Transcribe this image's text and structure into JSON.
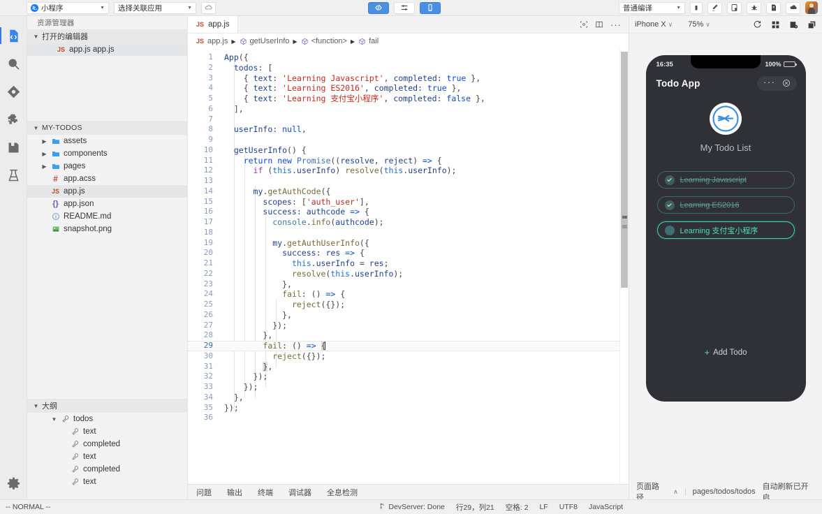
{
  "toolbar": {
    "app_select": {
      "label": "小程序",
      "icon": "alipay-logo-icon",
      "caret": "▼"
    },
    "project_select": {
      "label": "选择关联应用",
      "caret": "▼"
    },
    "cloud_button": "cloud-icon",
    "code_toggle": "code-brackets-icon",
    "settings_toggle": "sliders-icon",
    "device_toggle": "mobile-icon",
    "compile_select": {
      "label": "普通编译",
      "caret": "▼"
    },
    "stop_button": "stop-square-icon",
    "actions": [
      "clean-icon",
      "preview-qr-icon",
      "debug-bug-icon",
      "doc-icon",
      "upload-cloud-icon"
    ],
    "avatar": "user-avatar"
  },
  "activity_bar": {
    "items": [
      {
        "name": "explorer",
        "icon": "code-file-icon",
        "active": true
      },
      {
        "name": "search",
        "icon": "search-icon",
        "active": false
      },
      {
        "name": "source-control",
        "icon": "git-branch-icon",
        "active": false
      },
      {
        "name": "extensions",
        "icon": "puzzle-piece-icon",
        "active": false
      },
      {
        "name": "save-all",
        "icon": "floppy-disk-icon",
        "active": false
      },
      {
        "name": "test",
        "icon": "flask-icon",
        "active": false
      }
    ],
    "bottom": {
      "name": "settings",
      "icon": "gear-icon"
    }
  },
  "sidebar": {
    "title": "资源管理器",
    "open_editors": {
      "label": "打开的编辑器",
      "twisty": "▼",
      "items": [
        {
          "icon": "js-file-icon",
          "label": "app.js  app.js",
          "selected": true
        }
      ]
    },
    "project": {
      "label": "MY-TODOS",
      "twisty": "▼",
      "items": [
        {
          "icon": "folder-icon",
          "label": "assets",
          "twisty": "▶",
          "depth": 1,
          "selected": false
        },
        {
          "icon": "folder-icon",
          "label": "components",
          "twisty": "▶",
          "depth": 1,
          "selected": false
        },
        {
          "icon": "folder-icon",
          "label": "pages",
          "twisty": "▶",
          "depth": 1,
          "selected": false
        },
        {
          "icon": "acss-file-icon",
          "label": "app.acss",
          "twisty": "",
          "depth": 2,
          "selected": false
        },
        {
          "icon": "js-file-icon",
          "label": "app.js",
          "twisty": "",
          "depth": 2,
          "selected": true
        },
        {
          "icon": "json-file-icon",
          "label": "app.json",
          "twisty": "",
          "depth": 2,
          "selected": false
        },
        {
          "icon": "markdown-file-icon",
          "label": "README.md",
          "twisty": "",
          "depth": 2,
          "selected": false
        },
        {
          "icon": "image-file-icon",
          "label": "snapshot.png",
          "twisty": "",
          "depth": 2,
          "selected": false
        }
      ]
    },
    "outline": {
      "label": "大纲",
      "twisty": "▼",
      "items": [
        {
          "icon": "property-icon",
          "label": "todos",
          "twisty": "▼",
          "depth": 1
        },
        {
          "icon": "property-icon",
          "label": "text",
          "twisty": "",
          "depth": 2
        },
        {
          "icon": "property-icon",
          "label": "completed",
          "twisty": "",
          "depth": 2
        },
        {
          "icon": "property-icon",
          "label": "text",
          "twisty": "",
          "depth": 2
        },
        {
          "icon": "property-icon",
          "label": "completed",
          "twisty": "",
          "depth": 2
        },
        {
          "icon": "property-icon",
          "label": "text",
          "twisty": "",
          "depth": 2
        }
      ]
    }
  },
  "editor": {
    "tabs": [
      {
        "icon": "js-file-icon",
        "label": "app.js",
        "active": true
      }
    ],
    "tab_actions": [
      "split-editor-icon",
      "layout-icon",
      "more-actions-icon"
    ],
    "breadcrumb": [
      {
        "icon": "js-file-icon",
        "label": "app.js"
      },
      {
        "icon": "symbol-method-icon",
        "label": "getUserInfo"
      },
      {
        "icon": "symbol-method-icon",
        "label": "<function>"
      },
      {
        "icon": "symbol-method-icon",
        "label": "fail"
      }
    ],
    "breadcrumb_separator": "▶",
    "total_lines": 36,
    "current_line": 29,
    "code_lines": [
      "App({",
      "  todos: [",
      "    { text: 'Learning Javascript', completed: true },",
      "    { text: 'Learning ES2016', completed: true },",
      "    { text: 'Learning 支付宝小程序', completed: false },",
      "  ],",
      "",
      "  userInfo: null,",
      "",
      "  getUserInfo() {",
      "    return new Promise((resolve, reject) => {",
      "      if (this.userInfo) resolve(this.userInfo);",
      "",
      "      my.getAuthCode({",
      "        scopes: ['auth_user'],",
      "        success: authcode => {",
      "          console.info(authcode);",
      "",
      "          my.getAuthUserInfo({",
      "            success: res => {",
      "              this.userInfo = res;",
      "              resolve(this.userInfo);",
      "            },",
      "            fail: () => {",
      "              reject({});",
      "            },",
      "          });",
      "        },",
      "        fail: () => {",
      "          reject({});",
      "        },",
      "      });",
      "    });",
      "  },",
      "});",
      ""
    ]
  },
  "bottom_panel": {
    "tabs": [
      "问题",
      "输出",
      "终端",
      "调试器",
      "全息检测"
    ]
  },
  "status_bar": {
    "vim_mode": "-- NORMAL --",
    "devserver": "DevServer: Done",
    "devserver_icon": "branch-icon",
    "cursor_position": "行29，列21",
    "indent": "空格: 2",
    "eol": "LF",
    "encoding": "UTF8",
    "language": "JavaScript",
    "page_path_label": "页面路径",
    "page_path_caret": "∧",
    "page_path_value": "pages/todos/todos",
    "auto_refresh": "自动刷新已开启"
  },
  "simulator": {
    "device": "iPhone X",
    "device_caret": "∨",
    "zoom": "75%",
    "zoom_caret": "∨",
    "actions": [
      "refresh-icon",
      "grid-icon",
      "screenshot-icon",
      "multi-window-icon"
    ],
    "phone": {
      "time": "16:35",
      "battery": "100%",
      "nav_title": "Todo App",
      "capsule": {
        "more": "···",
        "close": "close-circle-icon"
      },
      "logo": "alipay-mini-program-logo",
      "heading": "My Todo List",
      "todos": [
        {
          "text": "Learning Javascript",
          "completed": true
        },
        {
          "text": "Learning ES2016",
          "completed": true
        },
        {
          "text": "Learning 支付宝小程序",
          "completed": false
        }
      ],
      "add_button": {
        "plus": "+",
        "label": "Add Todo"
      }
    }
  },
  "colors": {
    "accent_blue": "#4a90e2",
    "teal_active": "#4ee0b4",
    "teal_done": "#5f9b8f",
    "phone_bg": "#2f3136"
  }
}
